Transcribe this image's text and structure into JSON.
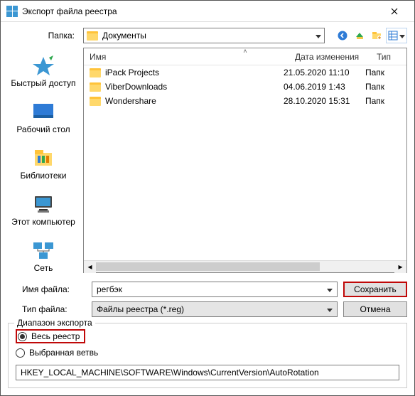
{
  "title": "Экспорт файла реестра",
  "folder": {
    "label": "Папка:",
    "value": "Документы"
  },
  "columns": {
    "name": "Имя",
    "date": "Дата изменения",
    "type": "Тип"
  },
  "items": [
    {
      "name": "iPack Projects",
      "date": "21.05.2020 11:10",
      "type": "Папк"
    },
    {
      "name": "ViberDownloads",
      "date": "04.06.2019 1:43",
      "type": "Папк"
    },
    {
      "name": "Wondershare",
      "date": "28.10.2020 15:31",
      "type": "Папк"
    }
  ],
  "places": {
    "quick": "Быстрый доступ",
    "desktop": "Рабочий стол",
    "libraries": "Библиотеки",
    "thispc": "Этот компьютер",
    "network": "Сеть"
  },
  "fields": {
    "filename_label": "Имя файла:",
    "filename_value": "регбэк",
    "filetype_label": "Тип файла:",
    "filetype_value": "Файлы реестра (*.reg)"
  },
  "buttons": {
    "save": "Сохранить",
    "cancel": "Отмена"
  },
  "export": {
    "legend": "Диапазон экспорта",
    "all": "Весь реестр",
    "branch": "Выбранная ветвь",
    "path": "HKEY_LOCAL_MACHINE\\SOFTWARE\\Windows\\CurrentVersion\\AutoRotation"
  }
}
